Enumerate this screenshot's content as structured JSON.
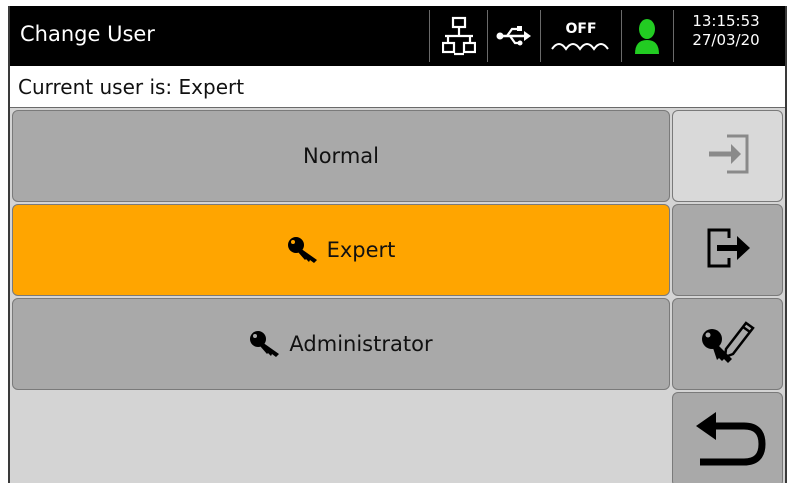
{
  "header": {
    "title": "Change User",
    "status_icons": [
      "network-icon",
      "usb-icon",
      "off-wave-icon",
      "user-status-icon"
    ],
    "off_label": "OFF",
    "time": "13:15:53",
    "date": "27/03/20",
    "user_status_color": "#22cc22"
  },
  "current_user": {
    "text": "Current user is: Expert"
  },
  "users": [
    {
      "label": "Normal",
      "icon": "none",
      "active": false
    },
    {
      "label": "Expert",
      "icon": "key-icon",
      "active": true
    },
    {
      "label": "Administrator",
      "icon": "key-icon",
      "active": false
    }
  ],
  "side_buttons": [
    "login-icon",
    "logout-icon",
    "edit-key-icon",
    "back-arrow-icon"
  ],
  "colors": {
    "active": "#ffa500",
    "button": "#a9a9a9",
    "disabled": "#d9d9d9",
    "header": "#000000"
  }
}
